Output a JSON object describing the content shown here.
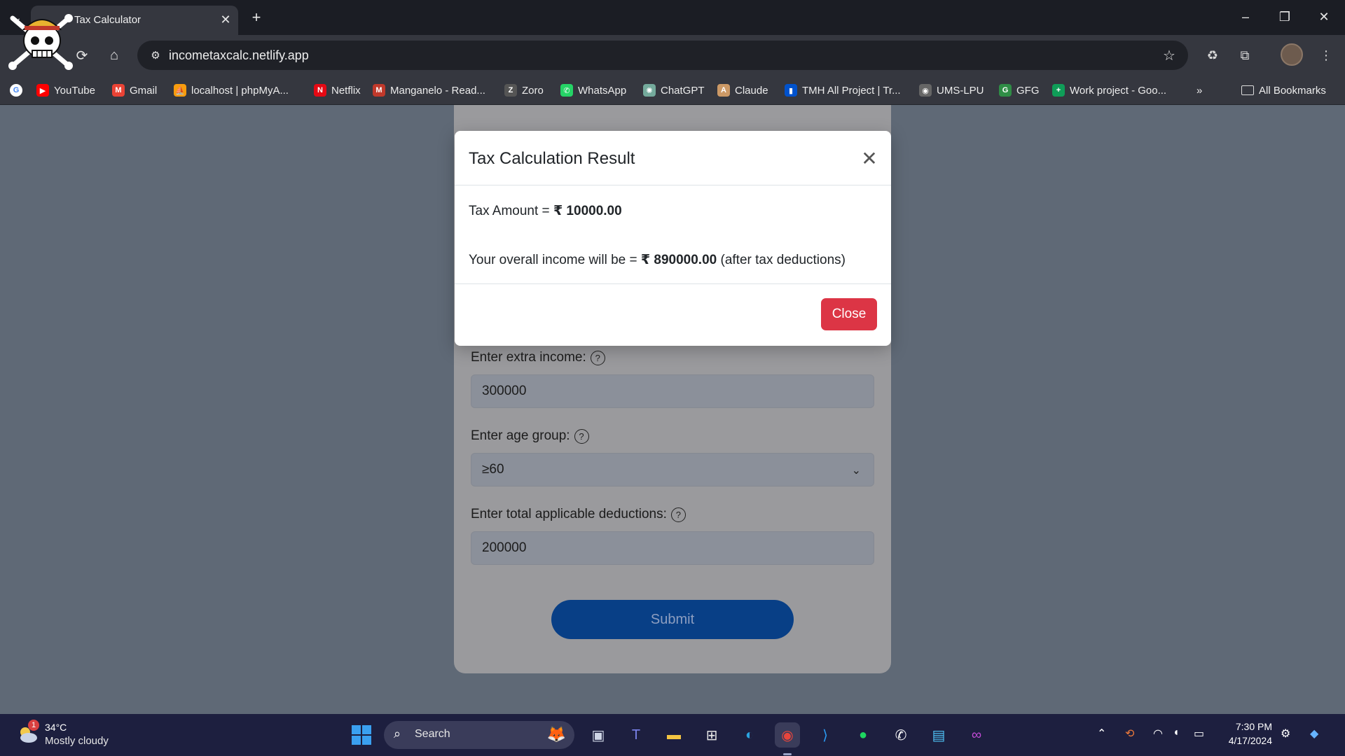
{
  "browser": {
    "tab_title": "Tax Calculator",
    "tab_close": "✕",
    "new_tab": "+",
    "url": "incometaxcalc.netlify.app",
    "window_controls": {
      "minimize": "–",
      "restore": "❐",
      "close": "✕"
    }
  },
  "bookmarks": [
    {
      "label": "YouTube",
      "icon": "youtube-icon",
      "color": "#ff0000",
      "glyph": "▶"
    },
    {
      "label": "Gmail",
      "icon": "gmail-icon",
      "color": "#ea4335",
      "glyph": "M"
    },
    {
      "label": "localhost | phpMyA...",
      "icon": "phpmyadmin-icon",
      "color": "#f89c0e",
      "glyph": "⛵"
    },
    {
      "label": "Netflix",
      "icon": "netflix-icon",
      "color": "#e50914",
      "glyph": "N"
    },
    {
      "label": "Manganelo - Read...",
      "icon": "manganelo-icon",
      "color": "#c0392b",
      "glyph": "M"
    },
    {
      "label": "Zoro",
      "icon": "zoro-icon",
      "color": "#555555",
      "glyph": "Z"
    },
    {
      "label": "WhatsApp",
      "icon": "whatsapp-icon",
      "color": "#25d366",
      "glyph": "✆"
    },
    {
      "label": "ChatGPT",
      "icon": "chatgpt-icon",
      "color": "#74aa9c",
      "glyph": "✺"
    },
    {
      "label": "Claude",
      "icon": "claude-icon",
      "color": "#cc9966",
      "glyph": "A"
    },
    {
      "label": "TMH All Project | Tr...",
      "icon": "trello-icon",
      "color": "#0052cc",
      "glyph": "▮"
    },
    {
      "label": "UMS-LPU",
      "icon": "ums-icon",
      "color": "#666666",
      "glyph": "◉"
    },
    {
      "label": "GFG",
      "icon": "gfg-icon",
      "color": "#2f8d46",
      "glyph": "G"
    },
    {
      "label": "Work project - Goo...",
      "icon": "sheets-icon",
      "color": "#0f9d58",
      "glyph": "+"
    }
  ],
  "bookmarks_more": "»",
  "all_bookmarks": "All Bookmarks",
  "form": {
    "extra_income_label": "Enter extra income:",
    "extra_income_value": "300000",
    "age_group_label": "Enter age group:",
    "age_group_value": "≥60",
    "deductions_label": "Enter total applicable deductions:",
    "deductions_value": "200000",
    "help_glyph": "?",
    "submit_label": "Submit"
  },
  "modal": {
    "title": "Tax Calculation Result",
    "close_x": "✕",
    "tax_prefix": "Tax Amount = ",
    "tax_value": "₹ 10000.00",
    "income_prefix": "Your overall income will be = ",
    "income_value": "₹ 890000.00",
    "income_suffix": " (after tax deductions)",
    "close_label": "Close"
  },
  "taskbar": {
    "weather_temp": "34°C",
    "weather_desc": "Mostly cloudy",
    "weather_badge": "1",
    "search_placeholder": "Search",
    "time": "7:30 PM",
    "date": "4/17/2024"
  },
  "colors": {
    "close_button": "#dc3545",
    "submit_button": "#083f86",
    "overlay": "#5f6976"
  }
}
